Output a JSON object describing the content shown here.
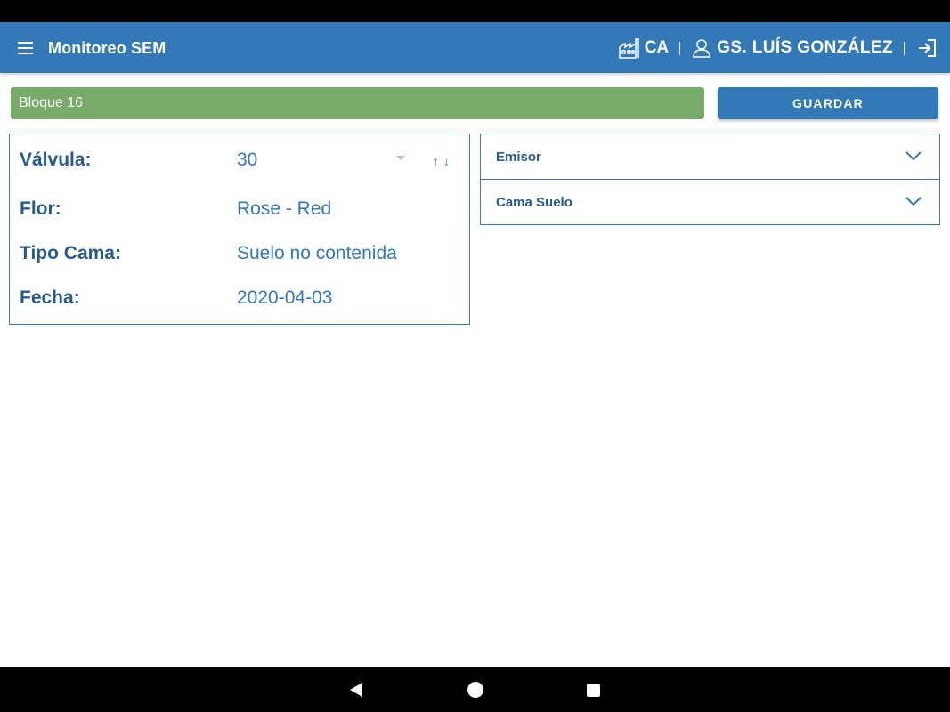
{
  "app": {
    "title": "Monitoreo SEM",
    "location_code": "CA",
    "user_name": "GS. LUÍS GONZÁLEZ",
    "icons": {
      "menu": "menu-icon",
      "location": "factory-icon",
      "user": "user-icon",
      "logout": "logout-icon"
    },
    "colors": {
      "primary": "#3479b7",
      "block_green": "#78ab6a",
      "label_dark_blue": "#275a8e",
      "border": "#3d7ab5"
    }
  },
  "toolbar": {
    "block_label": "Bloque 16",
    "save_label": "GUARDAR"
  },
  "info": {
    "valve_label": "Válvula:",
    "valve_value": "30",
    "sort_arrows": "↑↓",
    "flower_label": "Flor:",
    "flower_value": "Rose - Red",
    "bed_type_label": "Tipo Cama:",
    "bed_type_value": "Suelo no contenida",
    "date_label": "Fecha:",
    "date_value": "2020-04-03"
  },
  "accordions": [
    {
      "label": "Emisor"
    },
    {
      "label": "Cama Suelo"
    }
  ]
}
